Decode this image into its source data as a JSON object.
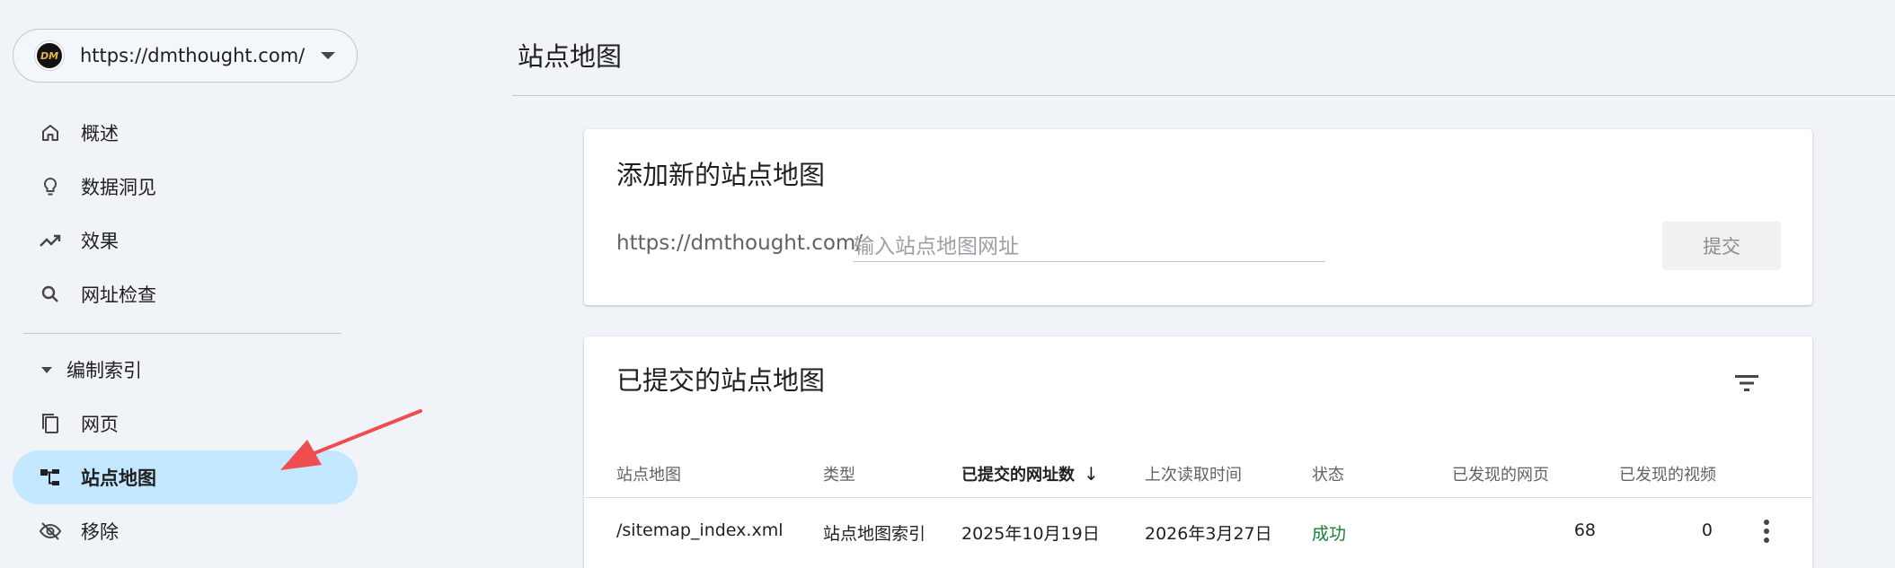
{
  "property": {
    "url": "https://dmthought.com/",
    "logo_text": "DM"
  },
  "nav": {
    "items": [
      {
        "label": "概述",
        "icon": "home-icon"
      },
      {
        "label": "数据洞见",
        "icon": "lightbulb-icon"
      },
      {
        "label": "效果",
        "icon": "trending-up-icon"
      },
      {
        "label": "网址检查",
        "icon": "search-icon"
      }
    ],
    "section_label": "编制索引",
    "section_items": [
      {
        "label": "网页",
        "icon": "pages-icon"
      },
      {
        "label": "站点地图",
        "icon": "sitemap-icon",
        "active": true
      },
      {
        "label": "移除",
        "icon": "visibility-off-icon"
      }
    ]
  },
  "page": {
    "title": "站点地图"
  },
  "add_card": {
    "title": "添加新的站点地图",
    "url_prefix": "https://dmthought.com/",
    "input_value": "",
    "input_placeholder": "输入站点地图网址",
    "submit_label": "提交"
  },
  "list_card": {
    "title": "已提交的站点地图",
    "columns": [
      "站点地图",
      "类型",
      "已提交的网址数",
      "上次读取时间",
      "状态",
      "已发现的网页",
      "已发现的视频"
    ],
    "sorted_column": "已提交的网址数",
    "rows": [
      {
        "sitemap": "/sitemap_index.xml",
        "type": "站点地图索引",
        "submitted": "2025年10月19日",
        "last_read": "2026年3月27日",
        "status": "成功",
        "pages": "68",
        "videos": "0"
      }
    ]
  },
  "colors": {
    "accent_active": "#c2e7ff",
    "status_success": "#188038",
    "annotation_arrow": "#f04e4e"
  }
}
